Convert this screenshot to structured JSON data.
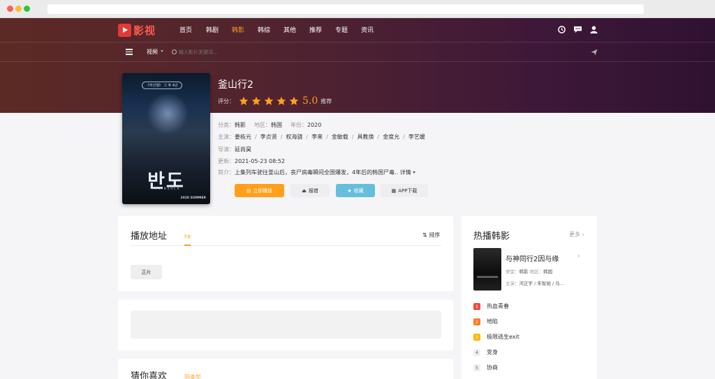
{
  "colors": {
    "accent": "#ff9f1a",
    "rank1": "#f04747",
    "rank2": "#ff7a1a",
    "rank3": "#ffb700",
    "rankOther": "#eeeeee",
    "fav": "#66bedb"
  },
  "logo": {
    "text": "影视"
  },
  "nav": [
    "首页",
    "韩剧",
    "韩影",
    "韩综",
    "其他",
    "推荐",
    "专题",
    "资讯"
  ],
  "nav_active_index": 2,
  "header_icons": [
    "history-icon",
    "comment-icon",
    "user-icon"
  ],
  "subnav": {
    "category": "视频",
    "search_placeholder": "输入影片关键词..."
  },
  "poster": {
    "tag": "《부산행》 그 후 4년",
    "title": "반도",
    "subtitle": "PENINSULA",
    "footer": "2020 SUMMER"
  },
  "movie": {
    "title": "釜山行2",
    "rating_label": "评分：",
    "stars": 5,
    "score": "5.0",
    "recommend": "推荐",
    "category_label": "分类：",
    "category": "韩影",
    "region_label": "地区：",
    "region": "韩国",
    "year_label": "年份：",
    "year": "2020",
    "cast_label": "主演：",
    "cast": [
      "姜栋元",
      "李贞贤",
      "权海骁",
      "李来",
      "金敏载",
      "具教焕",
      "金度允",
      "李艺媛"
    ],
    "director_label": "导演：",
    "director": "延尚昊",
    "updated_label": "更新：",
    "updated": "2021-05-23 08:52",
    "intro_label": "简介：",
    "intro": "上集列车驶往釜山后，丧尸病毒瞬间全国爆发，4年后的韩国尸毒..",
    "intro_more": "详情"
  },
  "buttons": {
    "play": "立即播放",
    "report": "报错",
    "favorite": "收藏",
    "app": "APP下载"
  },
  "play_section": {
    "title": "播放地址",
    "tab": "hk",
    "sort": "排序",
    "episodes": [
      "正片"
    ]
  },
  "guess_section": {
    "title": "猜你喜欢",
    "tab": "同类型"
  },
  "hot_section": {
    "title": "热播韩影",
    "more": "更多",
    "featured": {
      "name": "与神同行2因与缘",
      "type_label": "类型：",
      "type": "韩影",
      "region_label": "地区：",
      "region": "韩国",
      "cast_label": "主演：",
      "cast": "河正宇 / 朱智勋 / 马..."
    },
    "list": [
      {
        "rank": "1",
        "title": "热血青春"
      },
      {
        "rank": "2",
        "title": "地陷"
      },
      {
        "rank": "3",
        "title": "极限逃生exit"
      },
      {
        "rank": "4",
        "title": "变身"
      },
      {
        "rank": "5",
        "title": "协商"
      }
    ]
  }
}
